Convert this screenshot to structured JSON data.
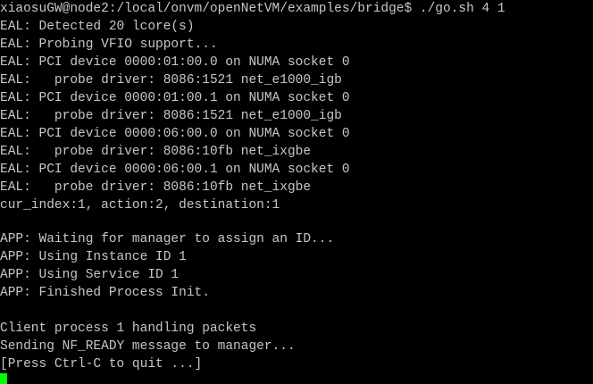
{
  "terminal": {
    "lines": [
      "xiaosuGW@node2:/local/onvm/openNetVM/examples/bridge$ ./go.sh 4 1",
      "EAL: Detected 20 lcore(s)",
      "EAL: Probing VFIO support...",
      "EAL: PCI device 0000:01:00.0 on NUMA socket 0",
      "EAL:   probe driver: 8086:1521 net_e1000_igb",
      "EAL: PCI device 0000:01:00.1 on NUMA socket 0",
      "EAL:   probe driver: 8086:1521 net_e1000_igb",
      "EAL: PCI device 0000:06:00.0 on NUMA socket 0",
      "EAL:   probe driver: 8086:10fb net_ixgbe",
      "EAL: PCI device 0000:06:00.1 on NUMA socket 0",
      "EAL:   probe driver: 8086:10fb net_ixgbe",
      "cur_index:1, action:2, destination:1",
      "",
      "APP: Waiting for manager to assign an ID...",
      "APP: Using Instance ID 1",
      "APP: Using Service ID 1",
      "APP: Finished Process Init.",
      "",
      "Client process 1 handling packets",
      "Sending NF_READY message to manager...",
      "[Press Ctrl-C to quit ...]"
    ],
    "colors": {
      "background": "#000000",
      "foreground": "#c7c7c7",
      "cursor": "#00ff00"
    }
  }
}
